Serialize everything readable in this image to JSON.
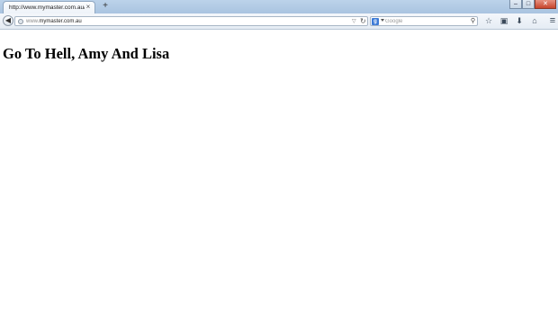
{
  "browser": {
    "tab": {
      "title": "http://www.mymaster.com.au/",
      "close_glyph": "×"
    },
    "new_tab_glyph": "+",
    "window_controls": {
      "minimize": "–",
      "maximize": "□",
      "close": "✕"
    },
    "nav": {
      "back_glyph": "◀",
      "url_prefix": "www.",
      "url_host": "mymaster.com.au",
      "dropdown_glyph": "▽",
      "reload_glyph": "↻"
    },
    "search": {
      "engine_letter": "g",
      "placeholder": "Google",
      "go_glyph": "⚲"
    },
    "toolbar": {
      "bookmark_glyph": "☆",
      "bookmarks_menu_glyph": "▣",
      "downloads_glyph": "⬇",
      "home_glyph": "⌂",
      "menu_glyph": "≡"
    },
    "icons": [
      "back-icon",
      "site-identity-icon",
      "reload-icon",
      "search-engine-icon",
      "magnifier-icon",
      "star-icon",
      "bookmarks-menu-icon",
      "download-icon",
      "home-icon",
      "hamburger-menu-icon"
    ],
    "colors": {
      "chrome": "#bcd3ea",
      "close_button": "#c7452d",
      "search_engine": "#3d7bd6"
    }
  },
  "page": {
    "heading": "Go To Hell, Amy And Lisa"
  }
}
